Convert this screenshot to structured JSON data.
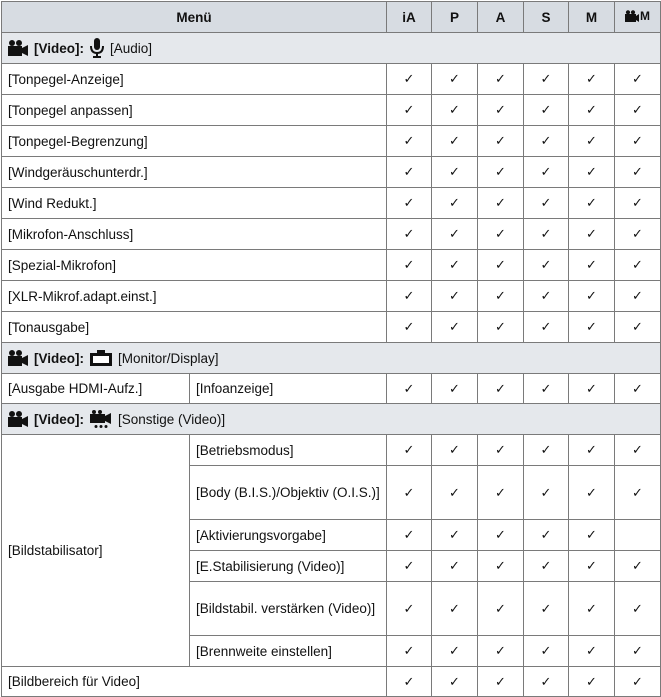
{
  "header": {
    "menu": "Menü",
    "modes": [
      "iA",
      "P",
      "A",
      "S",
      "M",
      "M"
    ]
  },
  "check": "✓",
  "icons": {
    "video": "movie-camera-icon",
    "audio": "microphone-icon",
    "monitor": "monitor-display-icon",
    "other": "film-other-icon",
    "creative_video": "creative-video-mode-icon"
  },
  "sections": {
    "audio": {
      "tag": "[Video]:",
      "label": "[Audio]"
    },
    "monitor": {
      "tag": "[Video]:",
      "label": "[Monitor/Display]"
    },
    "other": {
      "tag": "[Video]:",
      "label": "[Sonstige (Video)]"
    }
  },
  "audio_rows": [
    "[Tonpegel-Anzeige]",
    "[Tonpegel anpassen]",
    "[Tonpegel-Begrenzung]",
    "[Windgeräuschunterdr.]",
    "[Wind Redukt.]",
    "[Mikrofon-Anschluss]",
    "[Spezial-Mikrofon]",
    "[XLR-Mikrof.adapt.einst.]",
    "[Tonausgabe]"
  ],
  "monitor_row": {
    "main": "[Ausgabe HDMI-Aufz.]",
    "sub": "[Infoanzeige]"
  },
  "stabilizer": {
    "main": "[Bildstabilisator]",
    "subs": [
      "[Betriebsmodus]",
      "[Body (B.I.S.)/Objektiv (O.I.S.)]",
      "[Aktivierungsvorgabe]",
      "[E.Stabilisierung (Video)]",
      "[Bildstabil. verstärken (Video)]",
      "[Brennweite einstellen]"
    ]
  },
  "last_row": "[Bildbereich für Video]"
}
